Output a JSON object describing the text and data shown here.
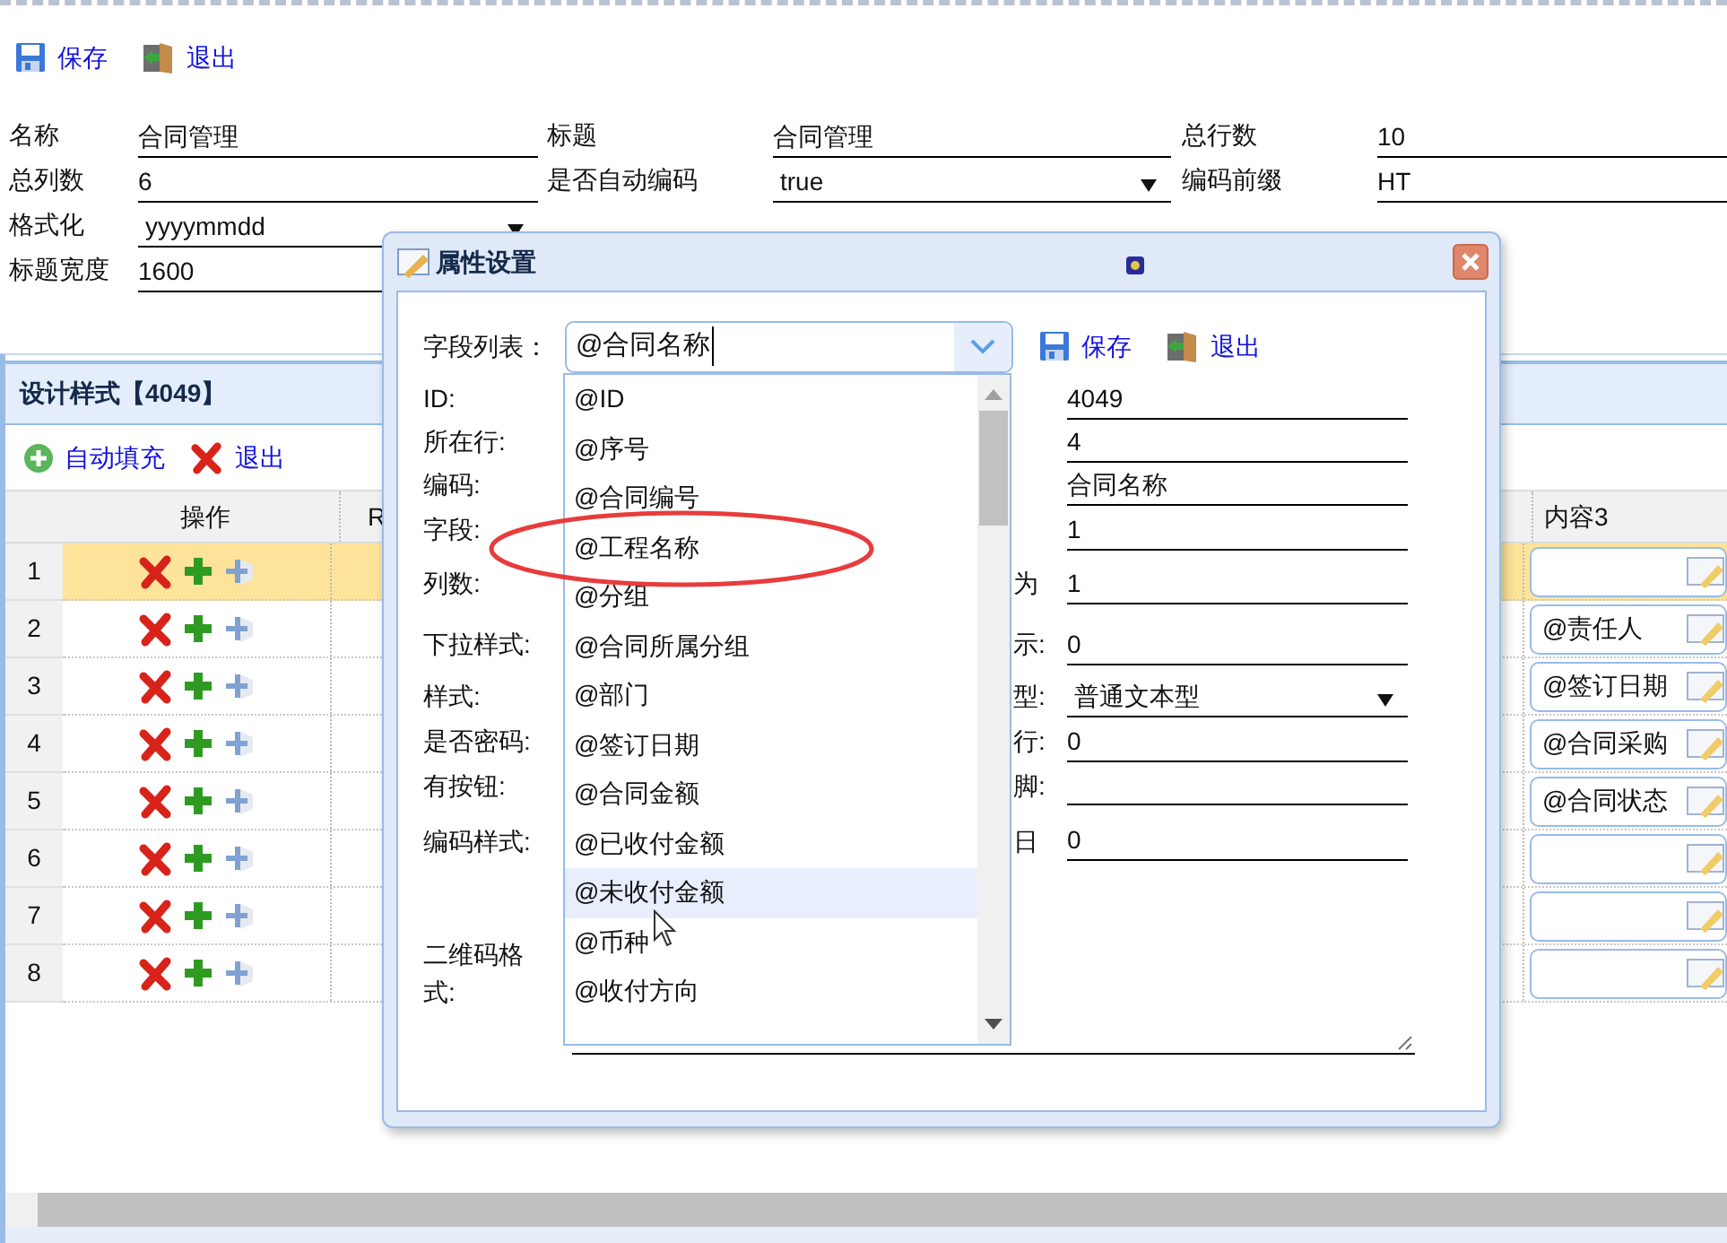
{
  "toolbar": [
    {
      "kind": "save",
      "label": "保存"
    },
    {
      "kind": "exit",
      "label": "退出"
    }
  ],
  "form": {
    "rows": [
      [
        {
          "label": "名称",
          "value": "合同管理",
          "kind": "text"
        },
        {
          "label": "标题",
          "value": "合同管理",
          "kind": "text"
        },
        {
          "label": "总行数",
          "value": "10",
          "kind": "text"
        }
      ],
      [
        {
          "label": "总列数",
          "value": "6",
          "kind": "text"
        },
        {
          "label": "是否自动编码",
          "value": "true",
          "kind": "select"
        },
        {
          "label": "编码前缀",
          "value": "HT",
          "kind": "text"
        }
      ],
      [
        {
          "label": "格式化",
          "value": "yyyymmdd",
          "kind": "select"
        }
      ],
      [
        {
          "label": "标题宽度",
          "value": "1600",
          "kind": "text"
        }
      ]
    ]
  },
  "panel": {
    "title": "设计样式【4049】",
    "toolbar": [
      {
        "kind": "add",
        "label": "自动填充"
      },
      {
        "kind": "exit",
        "label": "退出"
      }
    ],
    "table": {
      "columns": [
        "操作",
        "R",
        "内容3"
      ],
      "rows": [
        {
          "number": "1",
          "selected": true
        },
        {
          "number": "2",
          "selected": false,
          "content_3": "@责任人"
        },
        {
          "number": "3",
          "selected": false,
          "content_3": "@签订日期"
        },
        {
          "number": "4",
          "selected": false,
          "content_3": "@合同采购"
        },
        {
          "number": "5",
          "selected": false,
          "content_3": "@合同状态"
        },
        {
          "number": "6",
          "selected": false
        },
        {
          "number": "7",
          "selected": false
        },
        {
          "number": "8",
          "selected": false
        }
      ]
    }
  },
  "dialog": {
    "title": "属性设置",
    "field_list": {
      "label": "字段列表：",
      "value": "@合同名称"
    },
    "buttons": [
      {
        "kind": "save",
        "label": "保存"
      },
      {
        "kind": "exit",
        "label": "退出"
      }
    ],
    "rows": [
      {
        "label": "ID:",
        "value": "4049",
        "kind": "text"
      },
      {
        "label": "所在行:",
        "value": "4",
        "kind": "text"
      },
      {
        "label": "编码:",
        "value": "合同名称",
        "kind": "text"
      },
      {
        "label": "字段:",
        "value": "1",
        "kind": "text"
      },
      {
        "label": "列数:",
        "side_label": "为",
        "value": "1",
        "kind": "text"
      },
      {
        "label": "下拉样式:",
        "side_label": "示:",
        "value": "0",
        "kind": "text"
      },
      {
        "label": "样式:",
        "side_label": "型:",
        "value": "普通文本型",
        "kind": "select"
      },
      {
        "label": "是否密码:",
        "side_label": "行:",
        "value": "0",
        "kind": "text"
      },
      {
        "label": "有按钮:",
        "side_label": "脚:",
        "kind": "text"
      },
      {
        "label": "编码样式:",
        "side_label": "日",
        "value": "0",
        "kind": "text"
      }
    ],
    "qr_label": "二维码格式:",
    "dropdown": {
      "items": [
        {
          "label": "@ID",
          "highlighted": false
        },
        {
          "label": "@序号",
          "highlighted": false
        },
        {
          "label": "@合同编号",
          "highlighted": false
        },
        {
          "label": "@工程名称",
          "highlighted": false
        },
        {
          "label": "@分组",
          "highlighted": false
        },
        {
          "label": "@合同所属分组",
          "highlighted": false
        },
        {
          "label": "@部门",
          "highlighted": false
        },
        {
          "label": "@签订日期",
          "highlighted": false
        },
        {
          "label": "@合同金额",
          "highlighted": false
        },
        {
          "label": "@已收付金额",
          "highlighted": false
        },
        {
          "label": "@未收付金额",
          "highlighted": true
        },
        {
          "label": "@币种",
          "highlighted": false
        },
        {
          "label": "@收付方向",
          "highlighted": false
        }
      ]
    }
  }
}
